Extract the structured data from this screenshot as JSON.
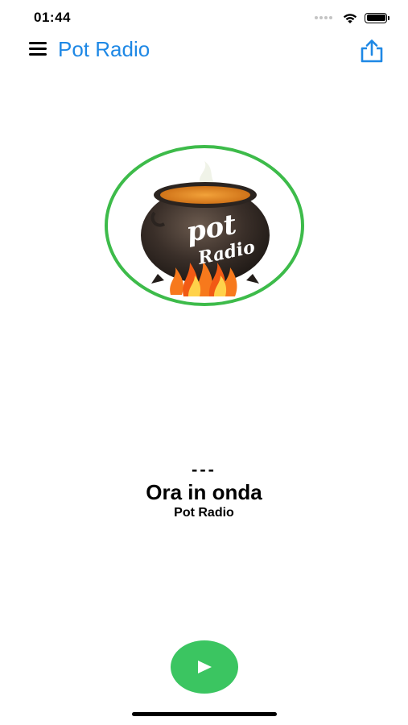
{
  "status_bar": {
    "time": "01:44",
    "icons": [
      "signal-icon",
      "wifi-icon",
      "battery-icon"
    ]
  },
  "nav": {
    "title": "Pot Radio",
    "menu_icon": "hamburger-menu-icon",
    "share_icon": "share-icon"
  },
  "logo": {
    "text_top": "pot",
    "text_bottom": "Radio",
    "ring_color": "#3dbb4a"
  },
  "now_playing": {
    "track": "---",
    "title": "Ora in onda",
    "station": "Pot Radio"
  },
  "player": {
    "play_icon": "play-icon",
    "accent_color": "#3bc561"
  },
  "colors": {
    "title_blue": "#1e88e5"
  }
}
